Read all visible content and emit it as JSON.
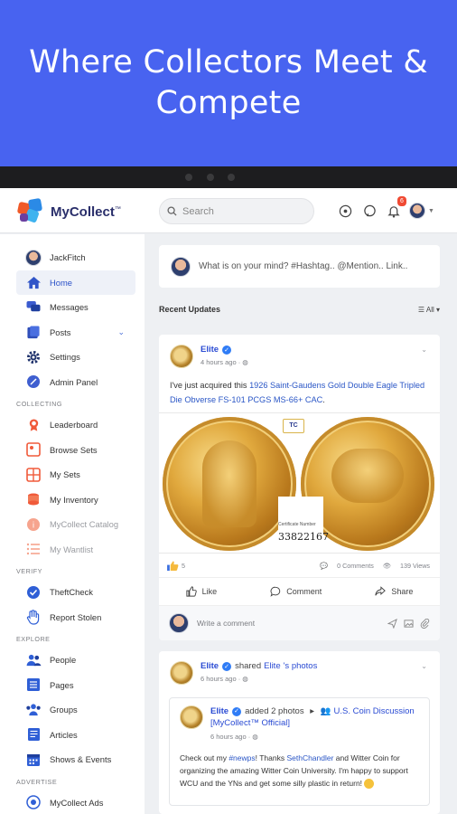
{
  "banner": {
    "headline": "Where Collectors Meet & Compete"
  },
  "app": {
    "brand": "MyCollect",
    "brand_mark": "™",
    "search_placeholder": "Search",
    "notification_count": "6",
    "composer_prompt": "What is on your mind? #Hashtag.. @Mention.. Link..",
    "colors": {
      "primary": "#4863f0",
      "link": "#2a4bd3",
      "verified": "#2f7cf6"
    }
  },
  "sidebar": {
    "user": "JackFitch",
    "items_main": [
      {
        "label": "Home",
        "icon": "home-icon"
      },
      {
        "label": "Messages",
        "icon": "messages-icon"
      },
      {
        "label": "Posts",
        "icon": "posts-icon"
      },
      {
        "label": "Settings",
        "icon": "gear-icon"
      },
      {
        "label": "Admin Panel",
        "icon": "admin-icon"
      }
    ],
    "section_collecting": "COLLECTING",
    "items_collecting": [
      {
        "label": "Leaderboard"
      },
      {
        "label": "Browse Sets"
      },
      {
        "label": "My Sets"
      },
      {
        "label": "My Inventory"
      },
      {
        "label": "MyCollect Catalog"
      },
      {
        "label": "My Wantlist"
      }
    ],
    "section_verify": "VERIFY",
    "items_verify": [
      {
        "label": "TheftCheck"
      },
      {
        "label": "Report Stolen"
      }
    ],
    "section_explore": "EXPLORE",
    "items_explore": [
      {
        "label": "People"
      },
      {
        "label": "Pages"
      },
      {
        "label": "Groups"
      },
      {
        "label": "Articles"
      },
      {
        "label": "Shows & Events"
      }
    ],
    "section_advertise": "ADVERTISE",
    "items_advertise": [
      {
        "label": "MyCollect Ads"
      }
    ]
  },
  "feed": {
    "heading": "Recent Updates",
    "filter": "All",
    "post1": {
      "author": "Elite",
      "time": "4 hours ago",
      "text_prefix": "I've just acquired this ",
      "link_text": "1926 Saint-Gaudens Gold Double Eagle Tripled Die Obverse FS-101 PCGS MS-66+ CAC",
      "text_suffix": ".",
      "cert_label": "Certificate Number",
      "cert_number": "33822167",
      "grader_badge": "TC",
      "likes": "5",
      "comments": "0 Comments",
      "views": "139 Views",
      "like_label": "Like",
      "comment_label": "Comment",
      "share_label": "Share",
      "comment_placeholder": "Write a comment"
    },
    "post2": {
      "author": "Elite",
      "action": "shared",
      "shared_owner": "Elite",
      "shared_object": "'s photos",
      "time": "6 hours ago",
      "inner_author": "Elite",
      "inner_action": "added 2 photos",
      "inner_group": "U.S. Coin Discussion",
      "inner_page": "[MyCollect™ Official]",
      "inner_time": "6 hours ago",
      "inner_text_a": "Check out my ",
      "inner_hashtag": "#newps",
      "inner_text_b": "! Thanks ",
      "inner_mention": "SethChandler",
      "inner_text_c": " and Witter Coin for organizing the amazing Witter Coin University. I'm happy to support WCU and the YNs and get some silly plastic in return! "
    }
  }
}
